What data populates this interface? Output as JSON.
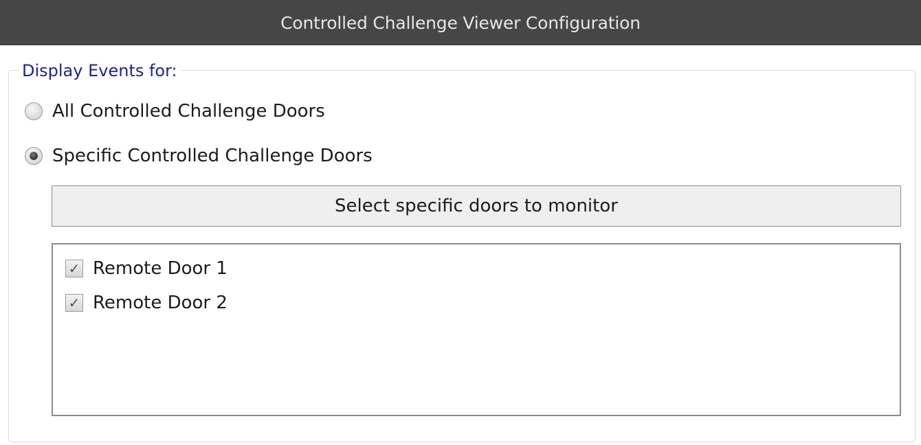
{
  "window": {
    "title": "Controlled Challenge Viewer Configuration"
  },
  "group": {
    "legend": "Display Events for:",
    "options": [
      {
        "label": "All Controlled Challenge Doors",
        "selected": false
      },
      {
        "label": "Specific Controlled Challenge Doors",
        "selected": true
      }
    ],
    "select_button_label": "Select specific doors to monitor",
    "doors": [
      {
        "label": "Remote Door 1",
        "checked": true,
        "check_glyph": "✓"
      },
      {
        "label": "Remote Door 2",
        "checked": true,
        "check_glyph": "✓"
      }
    ]
  },
  "colors": {
    "titlebar": "#464646",
    "legend_text": "#1f2296"
  },
  "icons": {
    "radio": "radio-icon",
    "checkbox": "checkbox-icon"
  }
}
